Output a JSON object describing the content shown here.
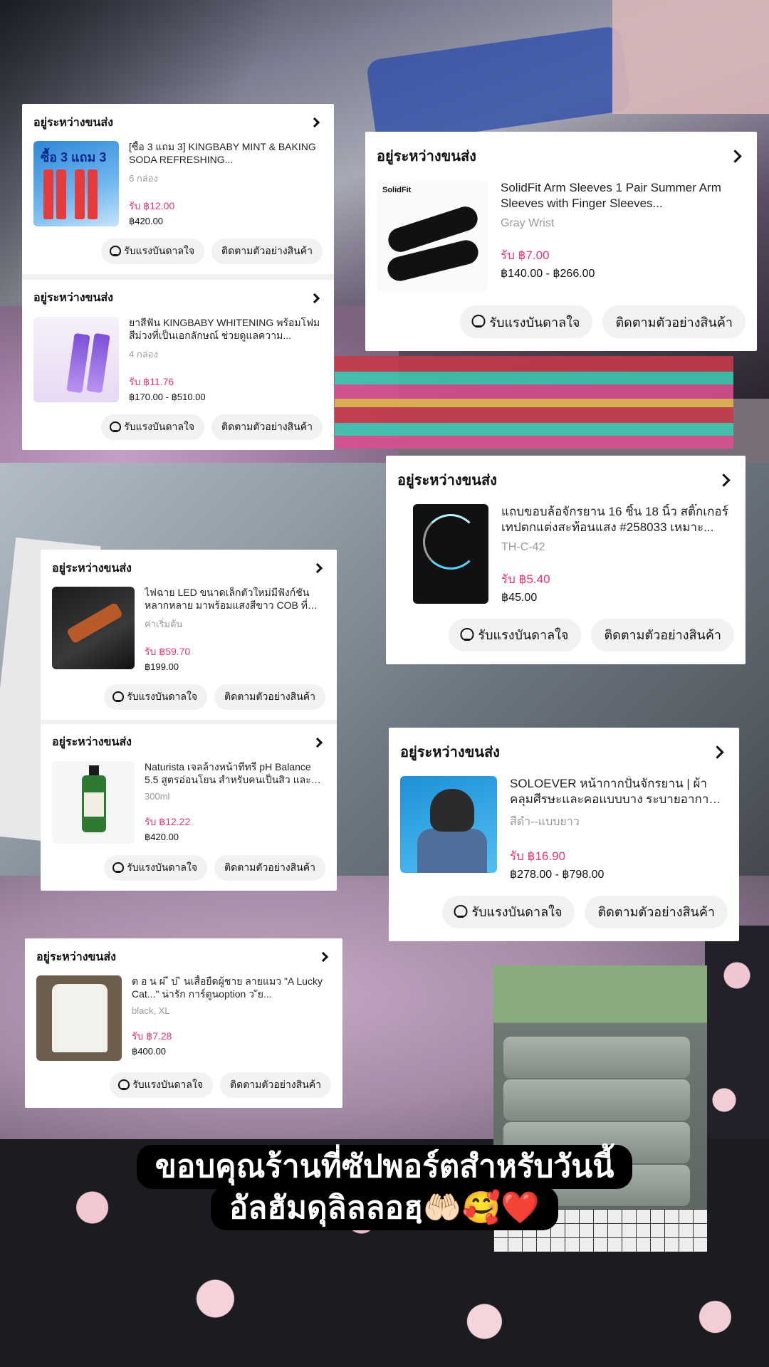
{
  "status_label": "อยู่ระหว่างขนส่ง",
  "buttons": {
    "inspire": "รับแรงบันดาลใจ",
    "track": "ติดตามตัวอย่างสินค้า"
  },
  "orders": [
    {
      "name": "[ซื้อ 3 แถม 3] KINGBABY MINT & BAKING SODA REFRESHING...",
      "variant": "6 กล่อง",
      "earn": "รับ ฿12.00",
      "price": "฿420.00",
      "thumb_text": "ซื้อ 3 แถม 3"
    },
    {
      "name": "ยาสีฟัน KINGBABY WHITENING พร้อมโฟมสีม่วงที่เป็นเอกลักษณ์ ช่วยดูแลความ...",
      "variant": "4 กล่อง",
      "earn": "รับ ฿11.76",
      "price": "฿170.00 - ฿510.00"
    },
    {
      "name": "SolidFit Arm Sleeves 1 Pair Summer Arm Sleeves with Finger Sleeves...",
      "variant": "Gray Wrist",
      "earn": "รับ ฿7.00",
      "price": "฿140.00 - ฿266.00",
      "thumb_text": "SolidFit"
    },
    {
      "name": "แถบขอบล้อจักรยาน 16 ชิ้น 18 นิ้ว สติ๊กเกอร์เทปตกแต่งสะท้อนแสง #258033 เหมาะ...",
      "variant": "TH-C-42",
      "earn": "รับ ฿5.40",
      "price": "฿45.00"
    },
    {
      "name": "ไฟฉาย LED ขนาดเล็กตัวใหม่มีฟังก์ชันหลากหลาย มาพร้อมแสงสีขาว COB ที่ปรั...",
      "variant": "ค่าเริ่มต้น",
      "earn": "รับ ฿59.70",
      "price": "฿199.00"
    },
    {
      "name": "Naturista เจลล้างหน้าทีทรี pH Balance 5.5 สูตรอ่อนโยน สำหรับคนเป็นสิว และผิว...",
      "variant": "300ml",
      "earn": "รับ ฿12.22",
      "price": "฿420.00"
    },
    {
      "name": "SOLOEVER หน้ากากปั่นจักรยาน | ผ้าคลุมศีรษะและคอแบบบาง ระบายอากาศได้ดี...",
      "variant": "สีดำ--แบบยาว",
      "earn": "รับ ฿16.90",
      "price": "฿278.00 - ฿798.00"
    },
    {
      "name": "ต อ น ผ ี บ ิ นเสื้อยืดผู้ชาย ลายแมว \"A Lucky Cat...\" น่ารัก การ์ตูนoption ว ัย...",
      "variant": "black, XL",
      "earn": "รับ ฿7.28",
      "price": "฿400.00"
    }
  ],
  "caption": {
    "line1": "ขอบคุณร้านที่ซัปพอร์ตสำหรับวันนี้",
    "line2": "อัลฮัมดุลิลลอฮฺ🤲🏻🥰❤️"
  },
  "colors": {
    "earn": "#e8367a",
    "card": "#ffffff",
    "button_bg": "#f2f2f2",
    "caption_bg": "#000000"
  }
}
